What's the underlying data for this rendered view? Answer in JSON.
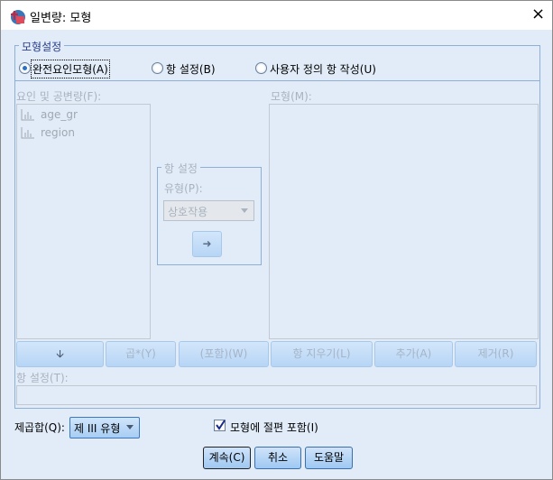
{
  "window": {
    "title": "일변량: 모형",
    "close_icon": "×"
  },
  "model_spec": {
    "legend": "모형설정",
    "options": [
      {
        "label": "완전요인모형(A)",
        "selected": true
      },
      {
        "label": "항 설정(B)",
        "selected": false
      },
      {
        "label": "사용자 정의 항 작성(U)",
        "selected": false
      }
    ]
  },
  "factors": {
    "label": "요인 및 공변량(F):",
    "items": [
      "age_gr",
      "region"
    ]
  },
  "model": {
    "label": "모형(M):"
  },
  "build_term": {
    "legend": "항 설정",
    "type_label": "유형(P):",
    "type_value": "상호작용"
  },
  "term_buttons": [
    "곱*(Y)",
    "(포함)(W)",
    "항 지우기(L)",
    "추가(A)",
    "제거(R)"
  ],
  "term_input": {
    "label": "항 설정(T):",
    "value": ""
  },
  "sum_of_squares": {
    "label": "제곱합(Q):",
    "value": "제 III 유형"
  },
  "intercept": {
    "label": "모형에 절편 포함(I)",
    "checked": true
  },
  "buttons": {
    "continue": "계속(C)",
    "cancel": "취소",
    "help": "도움말"
  }
}
